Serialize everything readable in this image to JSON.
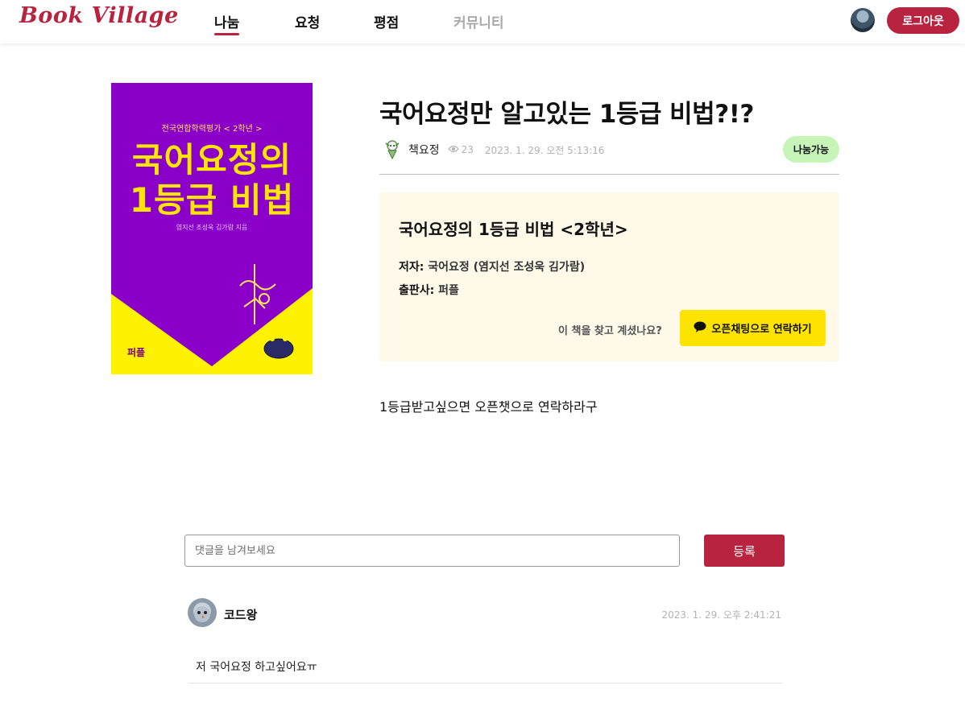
{
  "header": {
    "logo": "Book Village",
    "nav": [
      {
        "label": "나눔",
        "active": true
      },
      {
        "label": "요청",
        "active": false
      },
      {
        "label": "평점",
        "active": false
      },
      {
        "label": "커뮤니티",
        "active": false
      }
    ],
    "logout_label": "로그아웃"
  },
  "cover": {
    "subtitle": "전국연합학력평가 < 2학년 >",
    "title_line1": "국어요정의",
    "title_line2": "1등급 비법",
    "authors_small": "염지선 조성욱 김가람 지음",
    "publisher_mark": "퍼플"
  },
  "post": {
    "title": "국어요정만 알고있는 1등급 비법?!?",
    "author": "책요정",
    "views": "23",
    "date": "2023. 1. 29. 오전 5:13:16",
    "status": "나눔가능",
    "body": "1등급받고싶으면 오픈챗으로 연락하라구"
  },
  "book_info": {
    "title": "국어요정의 1등급 비법 <2학년>",
    "author_key": "저자:",
    "author_value": "국어요정 (염지선 조성욱 김가람)",
    "publisher_key": "출판사:",
    "publisher_value": "퍼플",
    "ask_text": "이 책을 찾고 계셨나요?",
    "contact_label": "오픈채팅으로 연락하기"
  },
  "comments": {
    "placeholder": "댓글을 남겨보세요",
    "submit_label": "등록",
    "items": [
      {
        "author": "코드왕",
        "date": "2023. 1. 29. 오후 2:41:21",
        "text": "저 국어요정 하고싶어요ㅠ"
      }
    ]
  },
  "colors": {
    "brand": "#b8233f",
    "status_badge": "#c7f5b8",
    "kakao": "#fde300",
    "info_box_bg": "#fff9ea"
  }
}
